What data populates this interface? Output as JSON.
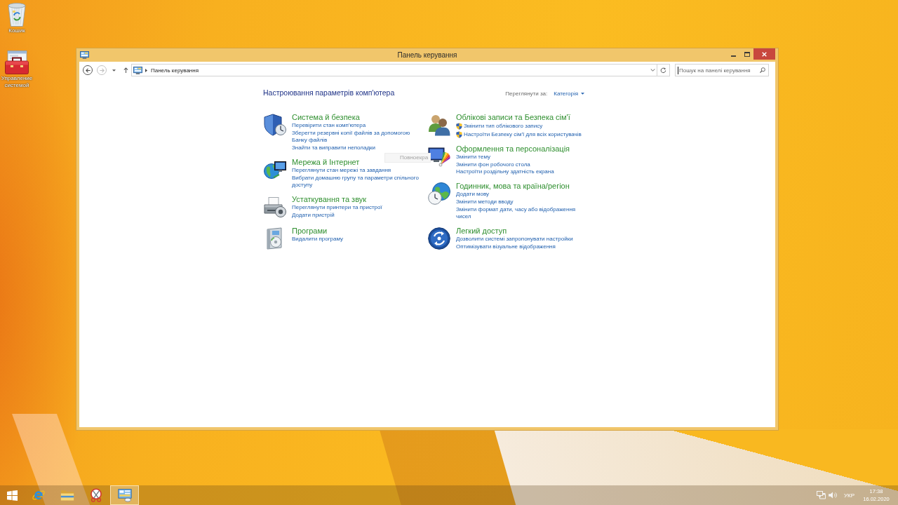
{
  "desktop": {
    "icons": [
      {
        "label": "Кошик"
      },
      {
        "label": "Управление системой"
      }
    ]
  },
  "window": {
    "title": "Панель керування",
    "navigation": {
      "back": {
        "disabled": false
      },
      "forward": {
        "disabled": true
      },
      "address": "Панель керування",
      "search": {
        "placeholder": "Пошук на панелі керування",
        "focused": true
      }
    },
    "content": {
      "heading": "Настроювання параметрів комп'ютера",
      "view_by": {
        "label": "Переглянути за:",
        "value": "Категорія"
      },
      "columns": [
        {
          "categories": [
            {
              "title": "Система й безпека",
              "links": [
                {
                  "text": "Перевірити стан комп'ютера",
                  "shield": false
                },
                {
                  "text": "Зберегти резервні копії файлів за допомогою Банку файлів",
                  "shield": false
                },
                {
                  "text": "Знайти та виправити неполадки",
                  "shield": false
                }
              ]
            },
            {
              "title": "Мережа й Інтернет",
              "links": [
                {
                  "text": "Переглянути стан мережі та завдання",
                  "shield": false
                },
                {
                  "text": "Вибрати домашню групу та параметри спільного доступу",
                  "shield": false
                }
              ]
            },
            {
              "title": "Устаткування та звук",
              "links": [
                {
                  "text": "Переглянути принтери та пристрої",
                  "shield": false
                },
                {
                  "text": "Додати пристрій",
                  "shield": false
                }
              ]
            },
            {
              "title": "Програми",
              "links": [
                {
                  "text": "Видалити програму",
                  "shield": false
                }
              ]
            }
          ]
        },
        {
          "categories": [
            {
              "title": "Облікові записи та Безпека сім'ї",
              "links": [
                {
                  "text": "Змінити тип облікового запису",
                  "shield": true
                },
                {
                  "text": "Настроїти Безпеку сім'ї для всіх користувачів",
                  "shield": true
                }
              ]
            },
            {
              "title": "Оформлення та персоналізація",
              "links": [
                {
                  "text": "Змінити тему",
                  "shield": false
                },
                {
                  "text": "Змінити фон робочого стола",
                  "shield": false
                },
                {
                  "text": "Настроїти роздільну здатність екрана",
                  "shield": false
                }
              ]
            },
            {
              "title": "Годинник, мова та країна/регіон",
              "links": [
                {
                  "text": "Додати мову",
                  "shield": false
                },
                {
                  "text": "Змінити методи вводу",
                  "shield": false
                },
                {
                  "text": "Змінити формат дати, часу або відображення чисел",
                  "shield": false
                }
              ]
            },
            {
              "title": "Легкий доступ",
              "links": [
                {
                  "text": "Дозволити системі запропонувати настройки",
                  "shield": false
                },
                {
                  "text": "Оптимізувати візуальне відображення",
                  "shield": false
                }
              ]
            }
          ]
        }
      ],
      "tooltip": {
        "text": "Повноекра"
      }
    }
  },
  "taskbar": {
    "apps": [
      {
        "selected": false
      },
      {
        "selected": false
      },
      {
        "selected": false
      },
      {
        "selected": true
      }
    ],
    "tray": {
      "language": "УКР",
      "time": "17:38",
      "date": "16.02.2020"
    }
  }
}
